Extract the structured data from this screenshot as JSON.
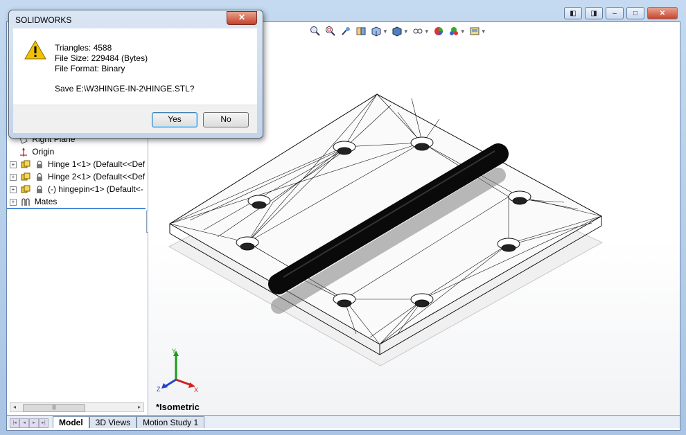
{
  "window": {
    "controls": [
      "◧",
      "◨",
      "–",
      "□",
      "✕"
    ]
  },
  "feature_tree": {
    "items": [
      {
        "label": "Right Plane",
        "icon": "plane-icon",
        "expander": ""
      },
      {
        "label": "Origin",
        "icon": "origin-icon",
        "expander": ""
      },
      {
        "label": "Hinge 1<1> (Default<<Def",
        "icon": "part-icon",
        "expander": "+"
      },
      {
        "label": "Hinge 2<1> (Default<<Def",
        "icon": "part-icon",
        "expander": "+"
      },
      {
        "label": "(-) hingepin<1> (Default<-",
        "icon": "part-icon",
        "expander": "+"
      },
      {
        "label": "Mates",
        "icon": "mates-icon",
        "expander": "+"
      }
    ],
    "collapse_glyph": "◂"
  },
  "bottom_tabs": {
    "nav": [
      "|◂",
      "◂",
      "▸",
      "▸|"
    ],
    "tabs": [
      "Model",
      "3D Views",
      "Motion Study 1"
    ],
    "active": "Model"
  },
  "viewport": {
    "view_label": "*Isometric",
    "hud_icons": [
      "zoom-to-fit-icon",
      "zoom-area-icon",
      "previous-view-icon",
      "section-view-icon",
      "view-orientation-icon",
      "display-style-icon",
      "hide-show-icon",
      "appearance-icon",
      "scene-icon",
      "view-settings-icon"
    ],
    "triad": {
      "x": "X",
      "y": "Y",
      "z": "Z"
    }
  },
  "dialog": {
    "title": "SOLIDWORKS",
    "close": "✕",
    "lines": [
      "Triangles: 4588",
      "File Size: 229484 (Bytes)",
      "File Format: Binary"
    ],
    "question": "Save E:\\W3HINGE-IN-2\\HINGE.STL?",
    "yes_label": "Yes",
    "no_label": "No"
  },
  "colors": {
    "selection_line": "#4a8ad8",
    "warning": "#f2c200",
    "axis_x": "#d22222",
    "axis_y": "#1a9a1a",
    "axis_z": "#2244cc"
  }
}
